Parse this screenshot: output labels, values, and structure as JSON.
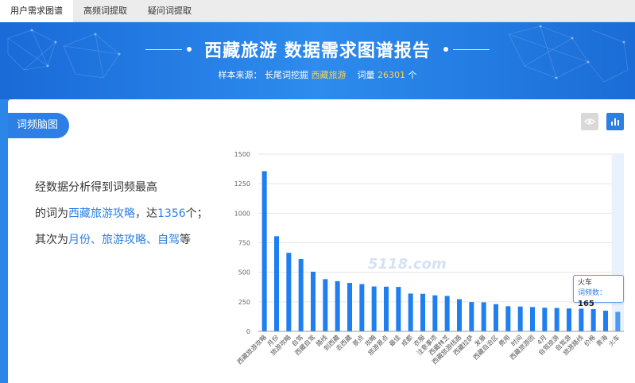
{
  "tabs": [
    {
      "label": "用户需求图谱",
      "active": true
    },
    {
      "label": "高频词提取",
      "active": false
    },
    {
      "label": "疑问词提取",
      "active": false
    }
  ],
  "banner": {
    "title": "西藏旅游 数据需求图谱报告",
    "sample_prefix": "样本来源：",
    "sample_tool": "长尾词挖掘",
    "sample_keyword": "西藏旅游",
    "count_prefix": "词量",
    "count_value": "26301",
    "count_unit": "个"
  },
  "section": {
    "tag": "词频脑图"
  },
  "summary": {
    "line1": "经数据分析得到词频最高",
    "line2_prefix": "的词为",
    "top_word": "西藏旅游攻略",
    "line2_mid": "，达",
    "top_value": "1356",
    "line2_suffix": "个；",
    "line3_prefix": "其次为",
    "second_words": "月份、旅游攻略、自驾",
    "line3_suffix": "等"
  },
  "watermark": "5118.com",
  "tooltip": {
    "name": "火车",
    "label": "词频数：",
    "value": "165"
  },
  "colors": {
    "accent": "#2d7fe6",
    "bar": "#1f7ff0",
    "highlight": "#ffd24a"
  },
  "chart_data": {
    "type": "bar",
    "categories": [
      "西藏旅游攻略",
      "月份",
      "旅游攻略",
      "自驾",
      "西藏自驾",
      "路线",
      "到西藏",
      "去西藏",
      "景点",
      "攻略",
      "旅游景点",
      "最佳",
      "成都",
      "衣服",
      "注意事项",
      "西藏林芝",
      "西藏旅游线路",
      "西藏拉萨",
      "发展",
      "西藏自治区",
      "费用",
      "时间",
      "西藏旅游团",
      "4月",
      "自驾旅游",
      "自驾游",
      "旅游路线",
      "价格",
      "青海",
      "火车"
    ],
    "values": [
      1356,
      805,
      665,
      612,
      505,
      442,
      425,
      410,
      400,
      380,
      378,
      376,
      320,
      318,
      305,
      300,
      272,
      248,
      246,
      230,
      213,
      210,
      206,
      200,
      198,
      194,
      192,
      188,
      175,
      165
    ],
    "ylim": [
      0,
      1500
    ],
    "yticks": [
      0,
      250,
      500,
      750,
      1000,
      1250,
      1500
    ],
    "highlighted_index": 29,
    "grid": true
  }
}
